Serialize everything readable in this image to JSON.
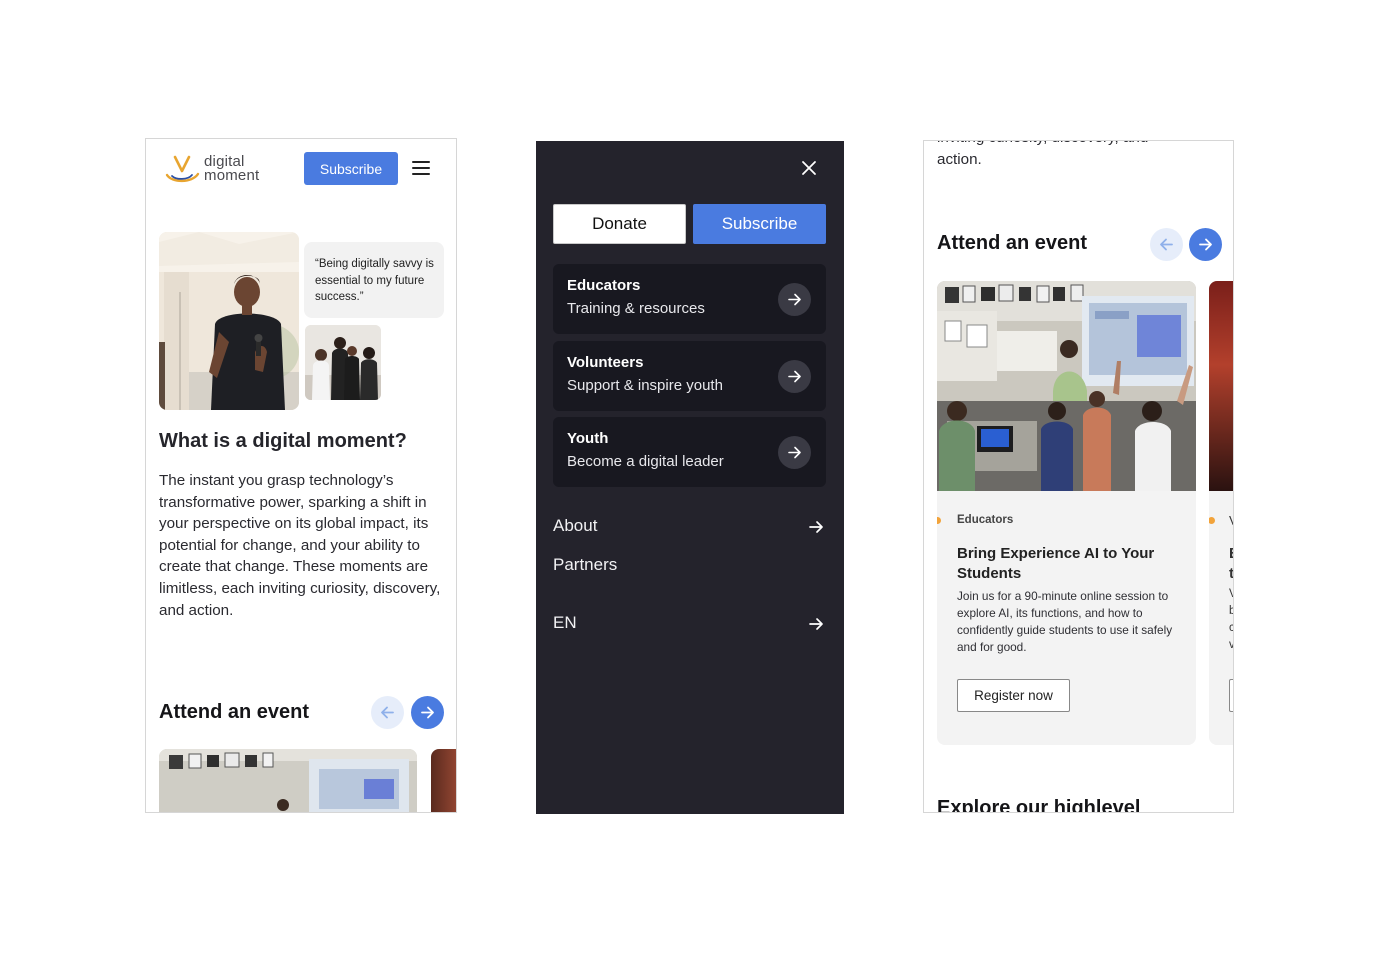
{
  "screen1": {
    "logo_line1": "digital",
    "logo_line2": "moment",
    "subscribe_label": "Subscribe",
    "quote": "“Being digitally savvy is essential to my future success.”",
    "heading": "What is a digital moment?",
    "body": "The instant you grasp technology’s transformative power, sparking a shift in your perspective on its global impact, its potential for change, and your ability to create that change. These moments are limitless, each inviting curiosity, discovery, and action.",
    "events_heading": "Attend an event"
  },
  "menu": {
    "donate_label": "Donate",
    "subscribe_label": "Subscribe",
    "cards": [
      {
        "title": "Educators",
        "subtitle": "Training & resources"
      },
      {
        "title": "Volunteers",
        "subtitle": "Support & inspire youth"
      },
      {
        "title": "Youth",
        "subtitle": "Become a digital leader"
      }
    ],
    "links": [
      {
        "label": "About"
      },
      {
        "label": "Partners"
      },
      {
        "label": "EN"
      }
    ]
  },
  "screen3": {
    "top_line1": "inviting curiosity, discovery, and",
    "top_line2": "action.",
    "events_heading": "Attend an event",
    "event": {
      "category": "Educators",
      "title": "Bring Experience AI to Your Students",
      "description": "Join us for a 90-minute online session to explore AI, its functions, and how to confidently guide students to use it safely and for good.",
      "button_label": "Register now"
    },
    "next_card_letters": [
      "V",
      "E",
      "t",
      "V",
      "b",
      "c",
      "v"
    ],
    "next_heading": "Explore our highlevel"
  },
  "colors": {
    "accent": "#4a7be0",
    "accent_light": "#e6edfa",
    "menu_bg": "#24232c",
    "menu_card_bg": "#181820",
    "category_dot": "#f2a33a",
    "logo_gold": "#e8a530"
  },
  "icons": [
    "logo-mark-icon",
    "hamburger-icon",
    "close-icon",
    "arrow-left-icon",
    "arrow-right-icon"
  ]
}
